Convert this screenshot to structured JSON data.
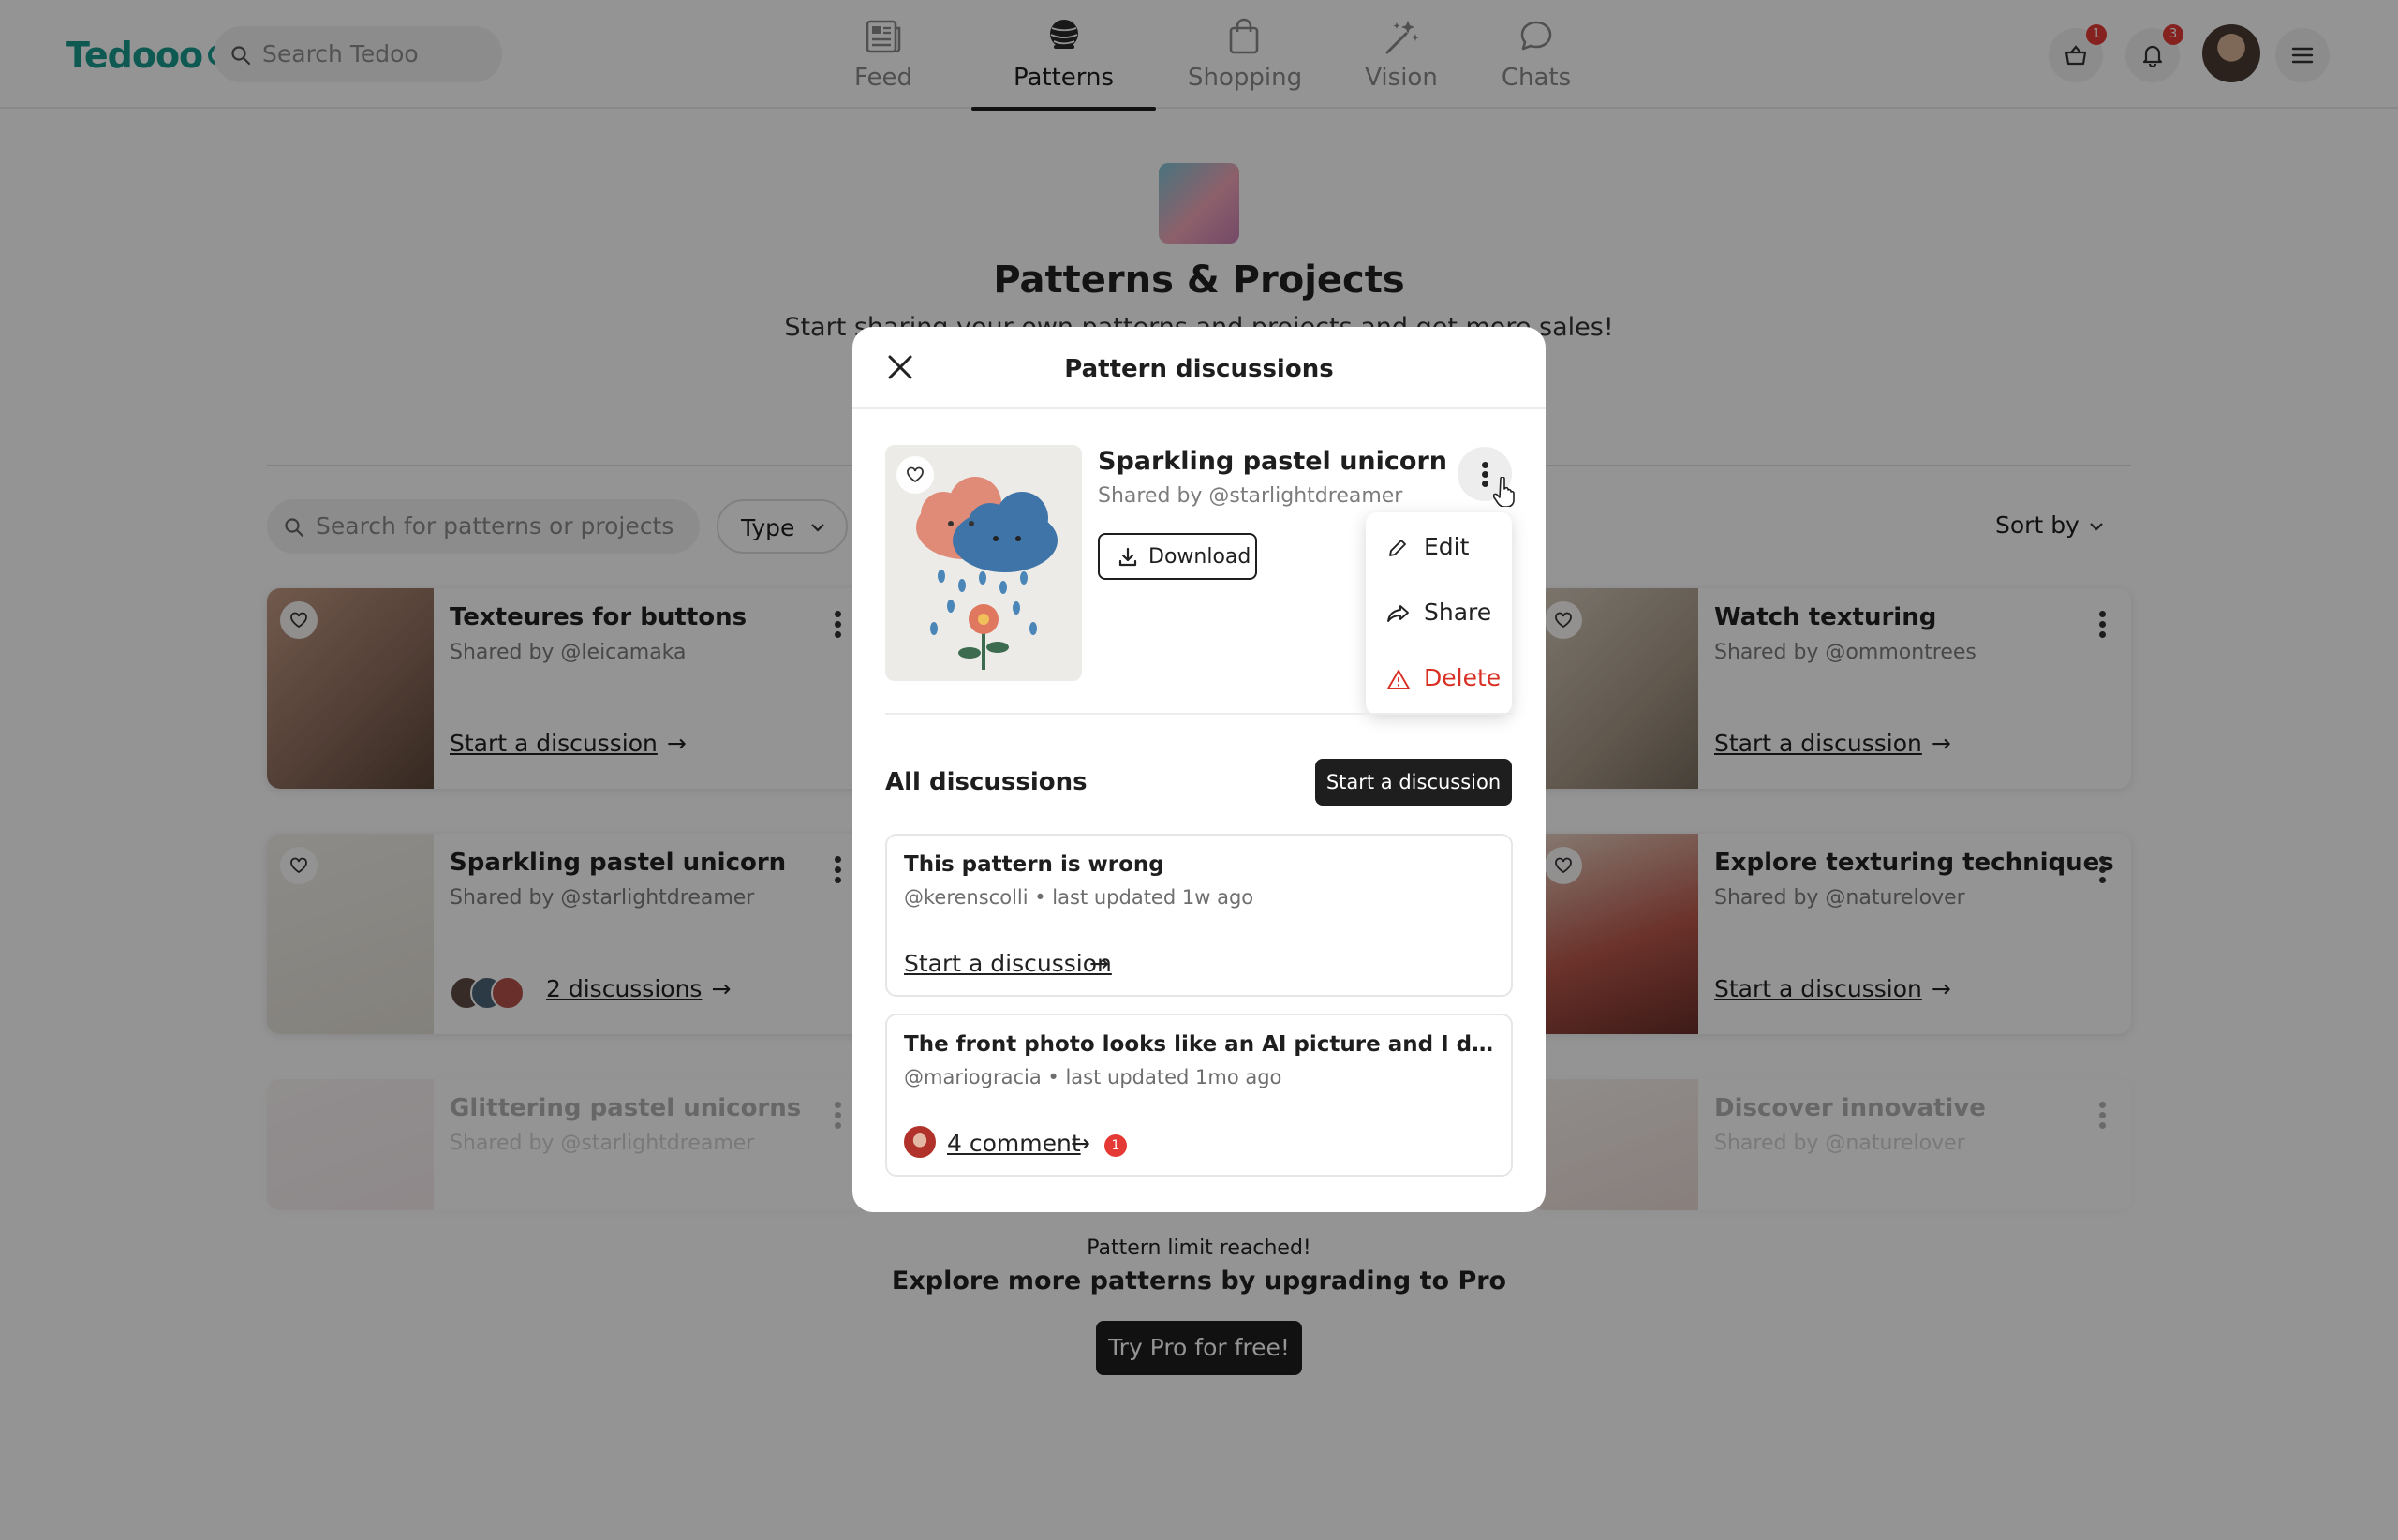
{
  "app": {
    "logo_text": "Tedooo",
    "brand_color": "#1b9a90"
  },
  "nav": {
    "search_placeholder": "Search Tedoo",
    "tabs": [
      {
        "label": "Feed",
        "icon": "newspaper-icon",
        "active": false
      },
      {
        "label": "Patterns",
        "icon": "yarn-ball-icon",
        "active": true
      },
      {
        "label": "Shopping",
        "icon": "shopping-bag-icon",
        "active": false
      },
      {
        "label": "Vision",
        "icon": "magic-wand-icon",
        "active": false
      },
      {
        "label": "Chats",
        "icon": "chat-bubble-icon",
        "active": false
      }
    ],
    "cart_badge": "1",
    "notifications_badge": "3"
  },
  "page": {
    "title": "Patterns & Projects",
    "subtitle": "Start sharing your own patterns and projects and get more sales!",
    "search_placeholder": "Search for patterns or projects",
    "type_filter": "Type",
    "sort_label": "Sort by"
  },
  "cards": [
    {
      "title": "Texteures for buttons",
      "by": "Shared by @leicamaka",
      "link": "Start a discussion"
    },
    {
      "title": "Watch texturing",
      "by": "Shared by @ommontrees",
      "link": "Start a discussion"
    },
    {
      "title": "Sparkling pastel unicorn",
      "by": "Shared by @starlightdreamer",
      "link": "2 discussions"
    },
    {
      "title": "Explore texturing techniques",
      "by": "Shared by @naturelover",
      "link": "Start a discussion"
    },
    {
      "title": "Glittering pastel unicorns",
      "by": "Shared by @starlightdreamer",
      "link": ""
    },
    {
      "title": "Discover innovative",
      "by": "Shared by @naturelover",
      "link": ""
    }
  ],
  "limit": {
    "text": "Pattern limit reached!",
    "sub": "Explore more patterns by upgrading to Pro",
    "button": "Try Pro for free!"
  },
  "modal": {
    "title": "Pattern discussions",
    "pattern_title": "Sparkling pastel unicorn",
    "pattern_by": "Shared by @starlightdreamer",
    "download": "Download",
    "menu": {
      "edit": "Edit",
      "share": "Share",
      "delete": "Delete",
      "delete_color": "#d93025"
    },
    "all_discussions": "All discussions",
    "start_discussion": "Start a discussion",
    "discussions": [
      {
        "title": "This pattern is wrong",
        "meta": "@kerenscolli • last updated 1w ago",
        "link": "Start a discussion"
      },
      {
        "title": "The front photo looks like an AI picture and I don't think thi...",
        "meta": "@mariogracia • last updated 1mo ago",
        "link": "4 comment",
        "badge": "1"
      }
    ]
  }
}
